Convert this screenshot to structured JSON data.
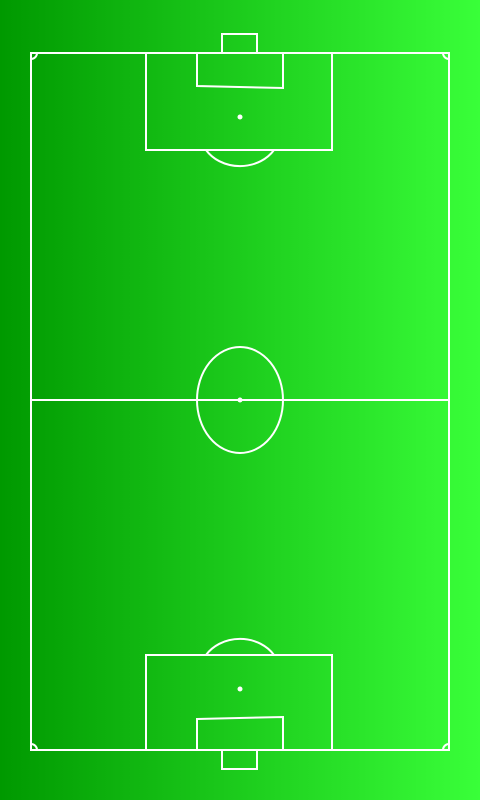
{
  "pitch": {
    "colors": {
      "grass_left": "#009900",
      "grass_right": "#39ff39",
      "line": "#ffffff"
    }
  }
}
